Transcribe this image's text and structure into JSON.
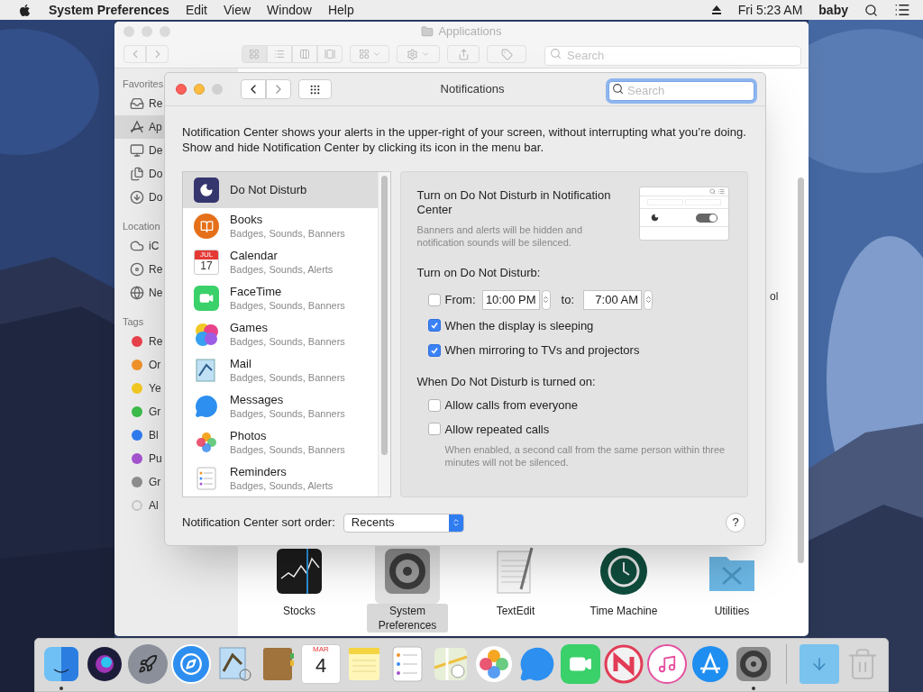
{
  "menu_bar": {
    "app": "System Preferences",
    "menus": [
      "Edit",
      "View",
      "Window",
      "Help"
    ],
    "clock": "Fri 5:23 AM",
    "user": "baby"
  },
  "finder": {
    "title": "Applications",
    "search": {
      "placeholder": "Search"
    },
    "sidebar": [
      {
        "heading": "Favorites",
        "items": [
          {
            "label": "Re",
            "kind": "place",
            "selected": false
          },
          {
            "label": "Ap",
            "kind": "place",
            "selected": true
          },
          {
            "label": "De",
            "kind": "place",
            "selected": false
          },
          {
            "label": "Do",
            "kind": "place",
            "selected": false
          },
          {
            "label": "Do",
            "kind": "place",
            "selected": false
          }
        ]
      },
      {
        "heading": "Location",
        "items": [
          {
            "label": "iC",
            "kind": "place",
            "selected": false
          },
          {
            "label": "Re",
            "kind": "place",
            "selected": false
          },
          {
            "label": "Ne",
            "kind": "place",
            "selected": false
          }
        ]
      },
      {
        "heading": "Tags",
        "items": [
          {
            "label": "Re",
            "kind": "tag",
            "color": "#e8424b",
            "selected": false
          },
          {
            "label": "Or",
            "kind": "tag",
            "color": "#f0922a",
            "selected": false
          },
          {
            "label": "Ye",
            "kind": "tag",
            "color": "#f2c924",
            "selected": false
          },
          {
            "label": "Gr",
            "kind": "tag",
            "color": "#3cbc4a",
            "selected": false
          },
          {
            "label": "Bl",
            "kind": "tag",
            "color": "#2f7cf0",
            "selected": false
          },
          {
            "label": "Pu",
            "kind": "tag",
            "color": "#a454cf",
            "selected": false
          },
          {
            "label": "Gr",
            "kind": "tag",
            "color": "#8e8e8e",
            "selected": false
          },
          {
            "label": "Al",
            "kind": "all_tags",
            "selected": false
          }
        ]
      }
    ],
    "cut_label": "ol",
    "apps": [
      {
        "label": "Stocks",
        "selected": false
      },
      {
        "label": "System Preferences",
        "selected": true
      },
      {
        "label": "TextEdit",
        "selected": false
      },
      {
        "label": "Time Machine",
        "selected": false
      },
      {
        "label": "Utilities",
        "selected": false
      }
    ]
  },
  "notifications": {
    "title": "Notifications",
    "search": {
      "placeholder": "Search"
    },
    "intro": "Notification Center shows your alerts in the upper-right of your screen, without interrupting what you’re doing. Show and hide Notification Center by clicking its icon in the menu bar.",
    "apps": [
      {
        "name": "Do Not Disturb",
        "selected": true
      },
      {
        "name": "Books",
        "detail": "Badges, Sounds, Banners",
        "selected": false
      },
      {
        "name": "Calendar",
        "detail": "Badges, Sounds, Alerts",
        "icon_month": "JUL",
        "icon_day": "17",
        "selected": false
      },
      {
        "name": "FaceTime",
        "detail": "Badges, Sounds, Banners",
        "selected": false
      },
      {
        "name": "Games",
        "detail": "Badges, Sounds, Banners",
        "selected": false
      },
      {
        "name": "Mail",
        "detail": "Badges, Sounds, Banners",
        "selected": false
      },
      {
        "name": "Messages",
        "detail": "Badges, Sounds, Banners",
        "selected": false
      },
      {
        "name": "Photos",
        "detail": "Badges, Sounds, Banners",
        "selected": false
      },
      {
        "name": "Reminders",
        "detail": "Badges, Sounds, Alerts",
        "selected": false
      }
    ],
    "dnd": {
      "heading": "Turn on Do Not Disturb in Notification Center",
      "note": "Banners and alerts will be hidden and notification sounds will be silenced.",
      "schedule_label": "Turn on Do Not Disturb:",
      "from": {
        "label": "From:",
        "checked": false,
        "value": "10:00 PM"
      },
      "to": {
        "label": "to:",
        "value": "7:00 AM"
      },
      "options": [
        {
          "label": "When the display is sleeping",
          "checked": true
        },
        {
          "label": "When mirroring to TVs and projectors",
          "checked": true
        }
      ],
      "when_on_label": "When Do Not Disturb is turned on:",
      "allow": [
        {
          "label": "Allow calls from everyone",
          "checked": false
        },
        {
          "label": "Allow repeated calls",
          "checked": false
        }
      ],
      "hint": "When enabled, a second call from the same person within three minutes will not be silenced."
    },
    "sort_label": "Notification Center sort order:",
    "sort_value": "Recents",
    "help": "?"
  },
  "dock": [
    {
      "running": true
    },
    {
      "running": false
    },
    {
      "running": false
    },
    {
      "running": false
    },
    {
      "running": false
    },
    {
      "running": false
    },
    {
      "running": false,
      "month": "MAR",
      "day": "4"
    },
    {
      "running": false
    },
    {
      "running": false
    },
    {
      "running": false
    },
    {
      "running": false
    },
    {
      "running": false
    },
    {
      "running": false
    },
    {
      "running": false
    },
    {
      "running": false
    },
    {
      "running": false
    },
    {
      "running": true
    },
    {
      "running": false
    },
    {
      "running": false
    }
  ]
}
